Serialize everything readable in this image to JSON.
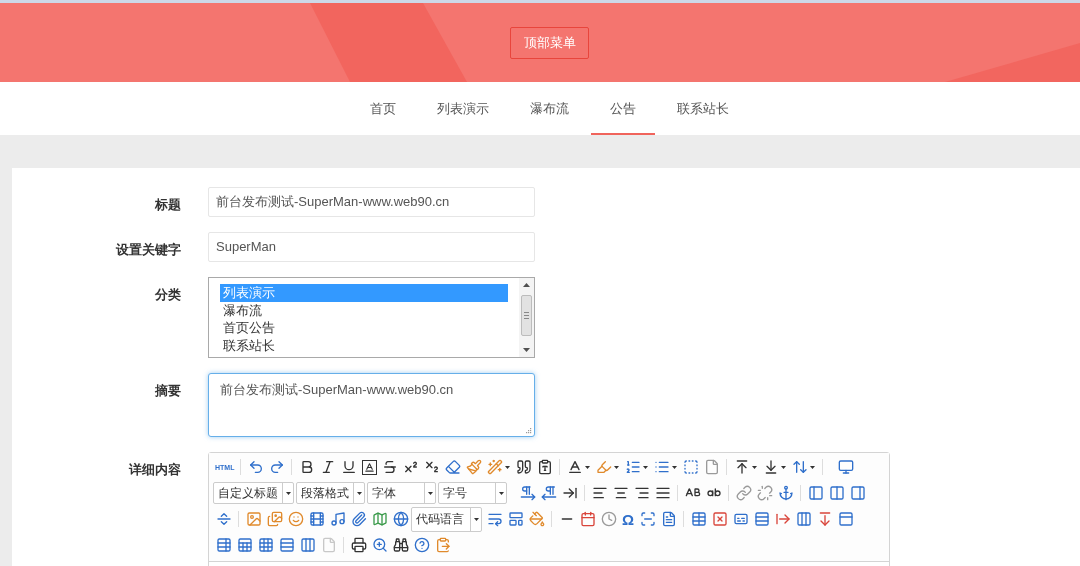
{
  "header": {
    "menu_button": "顶部菜单"
  },
  "nav": [
    {
      "label": "首页",
      "selected": false
    },
    {
      "label": "列表演示",
      "selected": false
    },
    {
      "label": "瀑布流",
      "selected": false
    },
    {
      "label": "公告",
      "selected": true
    },
    {
      "label": "联系站长",
      "selected": false
    }
  ],
  "form": {
    "fields": [
      {
        "kind": "input",
        "label": "标题",
        "value": "前台发布测试-SuperMan-www.web90.cn"
      },
      {
        "kind": "input",
        "label": "设置关键字",
        "value": "SuperMan"
      },
      {
        "kind": "listbox",
        "label": "分类",
        "options": [
          {
            "label": "列表演示",
            "selected": true
          },
          {
            "label": "瀑布流",
            "selected": false
          },
          {
            "label": "首页公告",
            "selected": false
          },
          {
            "label": "联系站长",
            "selected": false
          }
        ]
      },
      {
        "kind": "textarea",
        "label": "摘要",
        "value": "前台发布测试-SuperMan-www.web90.cn",
        "focused": true
      },
      {
        "kind": "editor",
        "label": "详细内容",
        "toolbar": {
          "html_button": "HTML",
          "heading_select": "自定义标题",
          "paragraph_select": "段落格式",
          "font_select": "字体",
          "size_select": "字号",
          "code_select": "代码语言",
          "special_char_button": "Ω"
        }
      }
    ]
  }
}
